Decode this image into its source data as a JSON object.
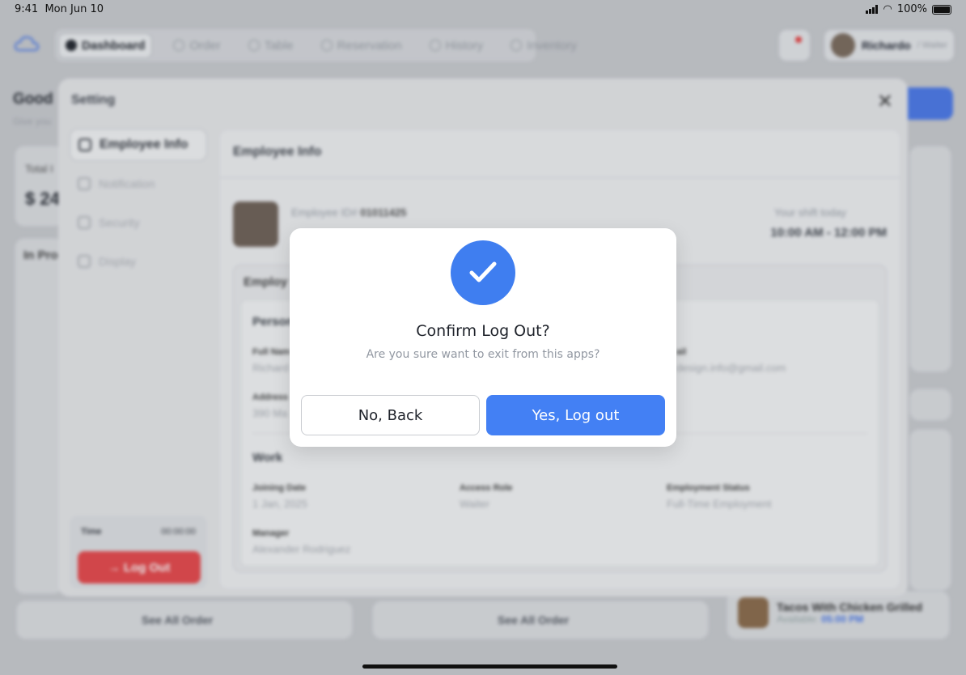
{
  "status_bar": {
    "time": "9:41",
    "date": "Mon Jun 10",
    "battery": "100%"
  },
  "nav": {
    "tabs": [
      {
        "label": "Dashboard",
        "icon": "dashboard-icon",
        "active": true
      },
      {
        "label": "Order",
        "icon": "order-icon"
      },
      {
        "label": "Table",
        "icon": "table-icon"
      },
      {
        "label": "Reservation",
        "icon": "calendar-icon"
      },
      {
        "label": "History",
        "icon": "clock-icon"
      },
      {
        "label": "Inventory",
        "icon": "store-icon"
      }
    ],
    "user_name": "Richardo",
    "user_role": "/ Waiter"
  },
  "background": {
    "greeting": "Good M",
    "greeting_sub": "Give you",
    "total_label": "Total I",
    "total_value": "$ 24",
    "in_progress": "In Pro",
    "see_all": "See All Order",
    "tacos_name": "Tacos With Chicken Grilled",
    "tacos_available_label": "Available:",
    "tacos_available_time": "05:00 PM"
  },
  "settings": {
    "title": "Setting",
    "menu": [
      {
        "label": "Employee Info",
        "icon": "person-icon",
        "active": true
      },
      {
        "label": "Notification",
        "icon": "bell-icon"
      },
      {
        "label": "Security",
        "icon": "lock-icon"
      },
      {
        "label": "Display",
        "icon": "display-icon"
      }
    ],
    "time_label": "Time",
    "time_value": "00:00:00",
    "logout_label": "Log Out",
    "content": {
      "header": "Employee Info",
      "employee_id_label": "Employee ID#",
      "employee_id": "01011425",
      "shift_label": "Your shift today",
      "shift_value": "10:00 AM - 12:00 PM",
      "box_title": "Employ",
      "personal_title": "Person",
      "full_name_label": "Full Nam",
      "full_name_value": "Richard",
      "email_label": "ail",
      "email_value": "design.info@gmail.com",
      "address_label": "Address",
      "address_value": "390 Ma",
      "work_title": "Work",
      "joining_label": "Joining Date",
      "joining_value": "1 Jan, 2025",
      "role_label": "Access Role",
      "role_value": "Waiter",
      "status_label": "Employment Status",
      "status_value": "Full-Time Employment",
      "manager_label": "Manager",
      "manager_value": "Alexander Rodriguez"
    }
  },
  "dialog": {
    "icon": "check-circle-icon",
    "title": "Confirm Log Out?",
    "subtitle": "Are you sure want to exit from this apps?",
    "cancel_label": "No, Back",
    "confirm_label": "Yes, Log out",
    "accent": "#4380f4"
  }
}
